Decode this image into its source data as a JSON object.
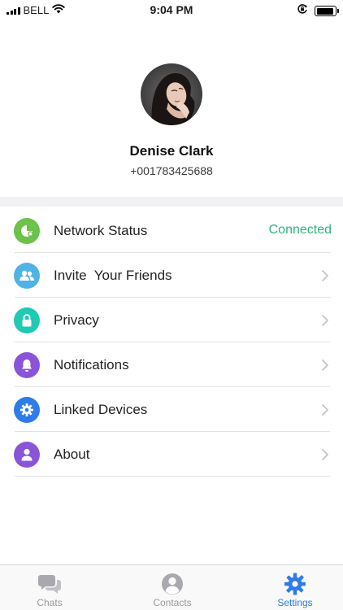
{
  "status_bar": {
    "carrier": "BELL",
    "time": "9:04 PM",
    "battery_level": 0.95,
    "icons": [
      "signal-icon",
      "wifi-icon",
      "orientation-lock-icon",
      "battery-icon"
    ]
  },
  "profile": {
    "name": "Denise Clark",
    "phone": "+001783425688"
  },
  "settings": {
    "items": [
      {
        "label": "Network Status",
        "value": "Connected",
        "icon": "network-status-icon",
        "color": "#6cc24a"
      },
      {
        "label": "Invite  Your Friends",
        "icon": "friends-icon",
        "color": "#4fb3e8"
      },
      {
        "label": "Privacy",
        "icon": "lock-icon",
        "color": "#20c9b4"
      },
      {
        "label": "Notifications",
        "icon": "bell-icon",
        "color": "#8a54d8"
      },
      {
        "label": "Linked Devices",
        "icon": "gear-icon",
        "color": "#2f7be8"
      },
      {
        "label": "About",
        "icon": "person-icon",
        "color": "#8a54d8"
      }
    ]
  },
  "tab_bar": {
    "tabs": [
      {
        "label": "Chats",
        "icon": "chat-bubbles-icon",
        "active": false
      },
      {
        "label": "Contacts",
        "icon": "contact-icon",
        "active": false
      },
      {
        "label": "Settings",
        "icon": "settings-gear-icon",
        "active": true
      }
    ]
  },
  "colors": {
    "accent": "#2f7be8",
    "connected": "#2fb47c",
    "inactive_tab": "#9a9aa0"
  }
}
